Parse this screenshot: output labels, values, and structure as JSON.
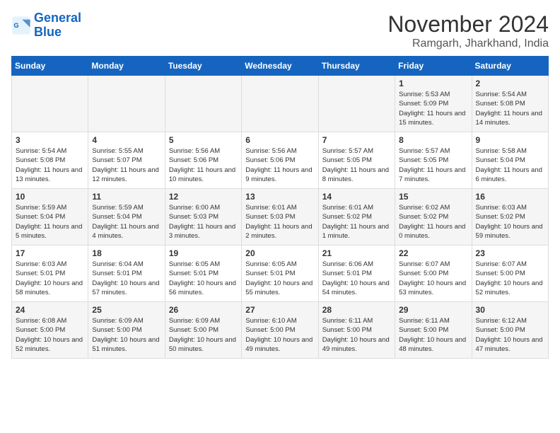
{
  "header": {
    "logo_line1": "General",
    "logo_line2": "Blue",
    "month": "November 2024",
    "location": "Ramgarh, Jharkhand, India"
  },
  "weekdays": [
    "Sunday",
    "Monday",
    "Tuesday",
    "Wednesday",
    "Thursday",
    "Friday",
    "Saturday"
  ],
  "weeks": [
    [
      {
        "day": "",
        "info": ""
      },
      {
        "day": "",
        "info": ""
      },
      {
        "day": "",
        "info": ""
      },
      {
        "day": "",
        "info": ""
      },
      {
        "day": "",
        "info": ""
      },
      {
        "day": "1",
        "info": "Sunrise: 5:53 AM\nSunset: 5:09 PM\nDaylight: 11 hours and 15 minutes."
      },
      {
        "day": "2",
        "info": "Sunrise: 5:54 AM\nSunset: 5:08 PM\nDaylight: 11 hours and 14 minutes."
      }
    ],
    [
      {
        "day": "3",
        "info": "Sunrise: 5:54 AM\nSunset: 5:08 PM\nDaylight: 11 hours and 13 minutes."
      },
      {
        "day": "4",
        "info": "Sunrise: 5:55 AM\nSunset: 5:07 PM\nDaylight: 11 hours and 12 minutes."
      },
      {
        "day": "5",
        "info": "Sunrise: 5:56 AM\nSunset: 5:06 PM\nDaylight: 11 hours and 10 minutes."
      },
      {
        "day": "6",
        "info": "Sunrise: 5:56 AM\nSunset: 5:06 PM\nDaylight: 11 hours and 9 minutes."
      },
      {
        "day": "7",
        "info": "Sunrise: 5:57 AM\nSunset: 5:05 PM\nDaylight: 11 hours and 8 minutes."
      },
      {
        "day": "8",
        "info": "Sunrise: 5:57 AM\nSunset: 5:05 PM\nDaylight: 11 hours and 7 minutes."
      },
      {
        "day": "9",
        "info": "Sunrise: 5:58 AM\nSunset: 5:04 PM\nDaylight: 11 hours and 6 minutes."
      }
    ],
    [
      {
        "day": "10",
        "info": "Sunrise: 5:59 AM\nSunset: 5:04 PM\nDaylight: 11 hours and 5 minutes."
      },
      {
        "day": "11",
        "info": "Sunrise: 5:59 AM\nSunset: 5:04 PM\nDaylight: 11 hours and 4 minutes."
      },
      {
        "day": "12",
        "info": "Sunrise: 6:00 AM\nSunset: 5:03 PM\nDaylight: 11 hours and 3 minutes."
      },
      {
        "day": "13",
        "info": "Sunrise: 6:01 AM\nSunset: 5:03 PM\nDaylight: 11 hours and 2 minutes."
      },
      {
        "day": "14",
        "info": "Sunrise: 6:01 AM\nSunset: 5:02 PM\nDaylight: 11 hours and 1 minute."
      },
      {
        "day": "15",
        "info": "Sunrise: 6:02 AM\nSunset: 5:02 PM\nDaylight: 11 hours and 0 minutes."
      },
      {
        "day": "16",
        "info": "Sunrise: 6:03 AM\nSunset: 5:02 PM\nDaylight: 10 hours and 59 minutes."
      }
    ],
    [
      {
        "day": "17",
        "info": "Sunrise: 6:03 AM\nSunset: 5:01 PM\nDaylight: 10 hours and 58 minutes."
      },
      {
        "day": "18",
        "info": "Sunrise: 6:04 AM\nSunset: 5:01 PM\nDaylight: 10 hours and 57 minutes."
      },
      {
        "day": "19",
        "info": "Sunrise: 6:05 AM\nSunset: 5:01 PM\nDaylight: 10 hours and 56 minutes."
      },
      {
        "day": "20",
        "info": "Sunrise: 6:05 AM\nSunset: 5:01 PM\nDaylight: 10 hours and 55 minutes."
      },
      {
        "day": "21",
        "info": "Sunrise: 6:06 AM\nSunset: 5:01 PM\nDaylight: 10 hours and 54 minutes."
      },
      {
        "day": "22",
        "info": "Sunrise: 6:07 AM\nSunset: 5:00 PM\nDaylight: 10 hours and 53 minutes."
      },
      {
        "day": "23",
        "info": "Sunrise: 6:07 AM\nSunset: 5:00 PM\nDaylight: 10 hours and 52 minutes."
      }
    ],
    [
      {
        "day": "24",
        "info": "Sunrise: 6:08 AM\nSunset: 5:00 PM\nDaylight: 10 hours and 52 minutes."
      },
      {
        "day": "25",
        "info": "Sunrise: 6:09 AM\nSunset: 5:00 PM\nDaylight: 10 hours and 51 minutes."
      },
      {
        "day": "26",
        "info": "Sunrise: 6:09 AM\nSunset: 5:00 PM\nDaylight: 10 hours and 50 minutes."
      },
      {
        "day": "27",
        "info": "Sunrise: 6:10 AM\nSunset: 5:00 PM\nDaylight: 10 hours and 49 minutes."
      },
      {
        "day": "28",
        "info": "Sunrise: 6:11 AM\nSunset: 5:00 PM\nDaylight: 10 hours and 49 minutes."
      },
      {
        "day": "29",
        "info": "Sunrise: 6:11 AM\nSunset: 5:00 PM\nDaylight: 10 hours and 48 minutes."
      },
      {
        "day": "30",
        "info": "Sunrise: 6:12 AM\nSunset: 5:00 PM\nDaylight: 10 hours and 47 minutes."
      }
    ]
  ]
}
